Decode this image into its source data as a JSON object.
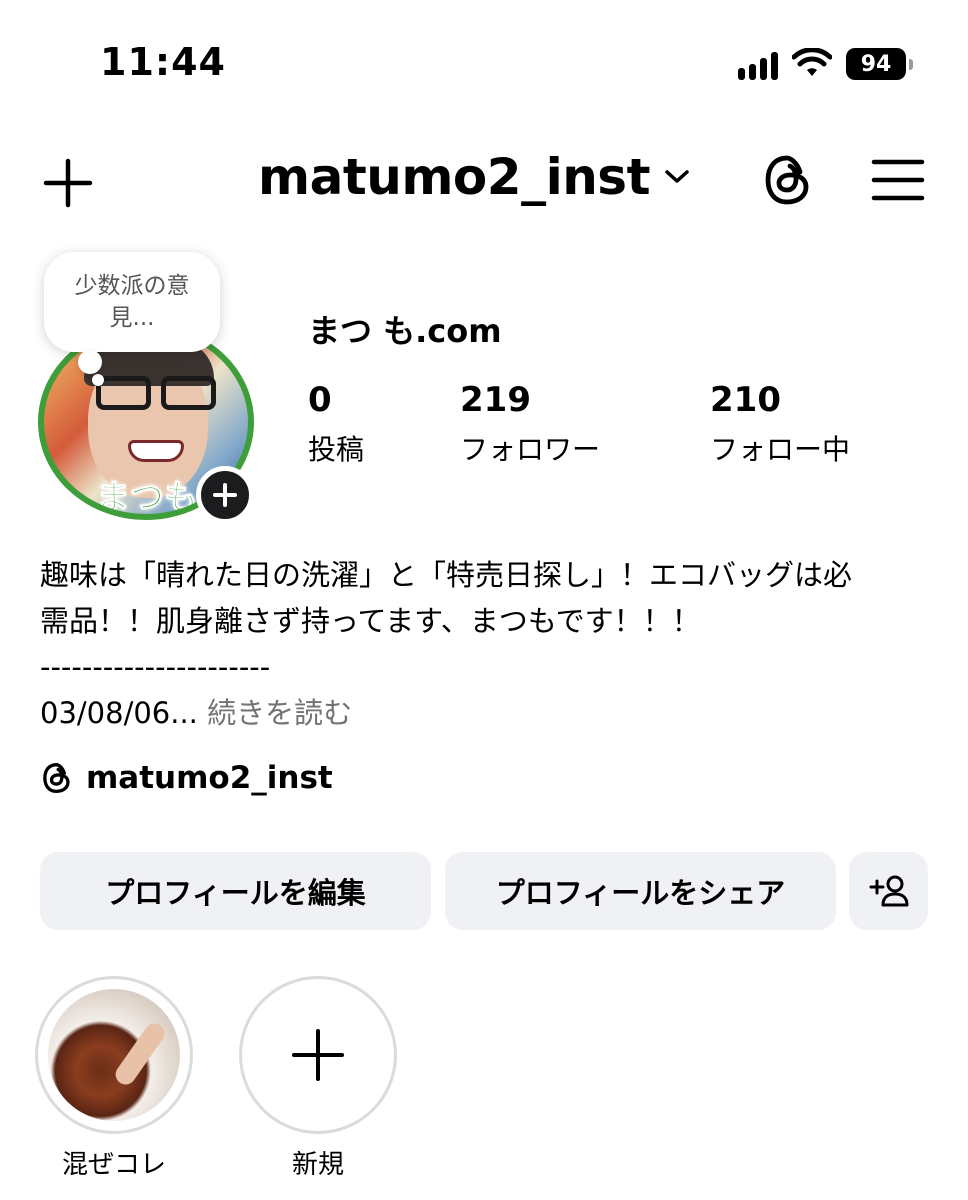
{
  "status_bar": {
    "time": "11:44",
    "battery": "94"
  },
  "header": {
    "username": "matumo2_inst"
  },
  "profile": {
    "note": "少数派の意見...",
    "avatar_label": "まつも",
    "display_name": "まつ も.com",
    "stats": [
      {
        "value": "0",
        "label": "投稿"
      },
      {
        "value": "219",
        "label": "フォロワー"
      },
      {
        "value": "210",
        "label": "フォロー中"
      }
    ],
    "bio": {
      "line1": "趣味は「晴れた日の洗濯」と「特売日探し」！エコバッグは必",
      "line2": "需品！！肌身離さず持ってます、まつもです！！！",
      "line3": "----------------------",
      "line4_prefix": "03/08/06...",
      "more": "続きを読む"
    },
    "threads_handle": "matumo2_inst"
  },
  "buttons": {
    "edit": "プロフィールを編集",
    "share": "プロフィールをシェア"
  },
  "highlights": [
    {
      "label": "混ぜコレ"
    },
    {
      "label": "新規"
    }
  ]
}
